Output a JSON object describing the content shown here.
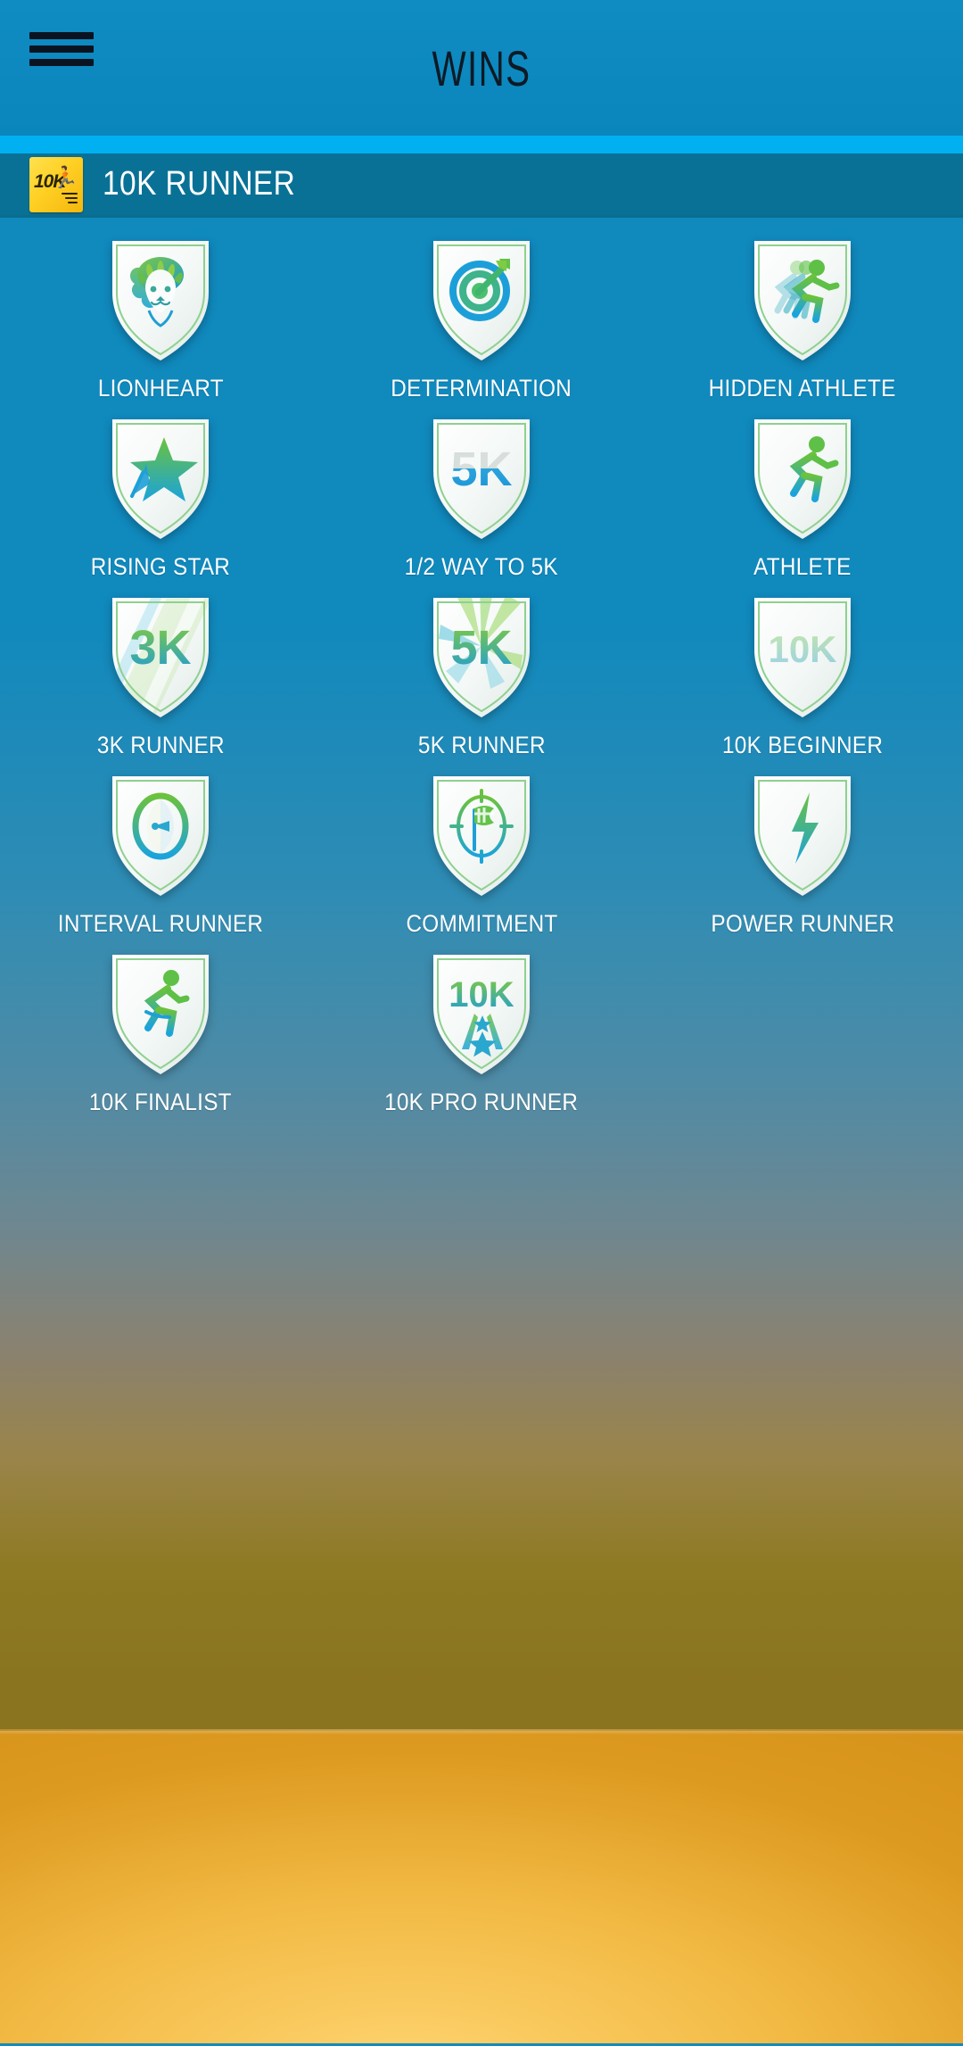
{
  "appbar": {
    "title": "WINS",
    "menu_icon": "hamburger-menu-icon"
  },
  "section": {
    "title": "10K RUNNER",
    "icon_label_10k": "10K",
    "icon_runner": "\\\\"
  },
  "badges": [
    {
      "label": "LIONHEART",
      "icon": "lion-head-icon",
      "locked": false
    },
    {
      "label": "DETERMINATION",
      "icon": "target-arrow-icon",
      "locked": false
    },
    {
      "label": "HIDDEN ATHLETE",
      "icon": "running-trio-icon",
      "locked": false
    },
    {
      "label": "RISING STAR",
      "icon": "shooting-star-icon",
      "locked": false
    },
    {
      "label": "1/2 WAY TO 5K",
      "icon": "half-5k-icon",
      "locked": false
    },
    {
      "label": "ATHLETE",
      "icon": "runner-icon",
      "locked": false
    },
    {
      "label": "3K RUNNER",
      "icon": "3k-stripes-icon",
      "locked": false
    },
    {
      "label": "5K RUNNER",
      "icon": "5k-sunburst-icon",
      "locked": false
    },
    {
      "label": "10K BEGINNER",
      "icon": "10k-faded-icon",
      "locked": true
    },
    {
      "label": "INTERVAL RUNNER",
      "icon": "stopwatch-dial-icon",
      "locked": false
    },
    {
      "label": "COMMITMENT",
      "icon": "checkered-flag-target-icon",
      "locked": false
    },
    {
      "label": "POWER RUNNER",
      "icon": "lightning-bolt-icon",
      "locked": false
    },
    {
      "label": "10K FINALIST",
      "icon": "finalist-runner-icon",
      "locked": false
    },
    {
      "label": "10K PRO RUNNER",
      "icon": "10k-stars-icon",
      "locked": false
    }
  ],
  "colors": {
    "appbar": "#0f8cc2",
    "strip": "#00b0f0",
    "section_header": "#0a7196",
    "board_top": "#1089bd",
    "board_bottom": "#8a7420",
    "bottom_panel": "#f2ba44",
    "app_icon": "#ffd024",
    "badge_green": "#5cc23f",
    "badge_blue": "#1aa3dd",
    "label_text": "#ffffff"
  }
}
